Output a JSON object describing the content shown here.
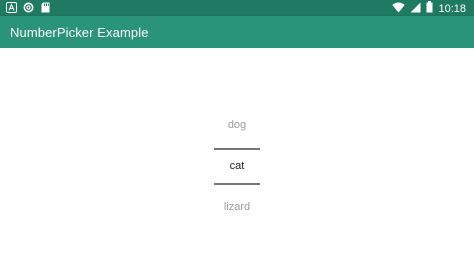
{
  "status_bar": {
    "time": "10:18",
    "icons": [
      "app-a-icon",
      "sync-icon",
      "sd-card-icon",
      "wifi-icon",
      "signal-icon",
      "battery-icon"
    ],
    "background_color": "#1f7a62"
  },
  "app_bar": {
    "title": "NumberPicker Example",
    "background_color": "#2a9478"
  },
  "picker": {
    "previous_value": "dog",
    "selected_value": "cat",
    "next_value": "lizard"
  }
}
